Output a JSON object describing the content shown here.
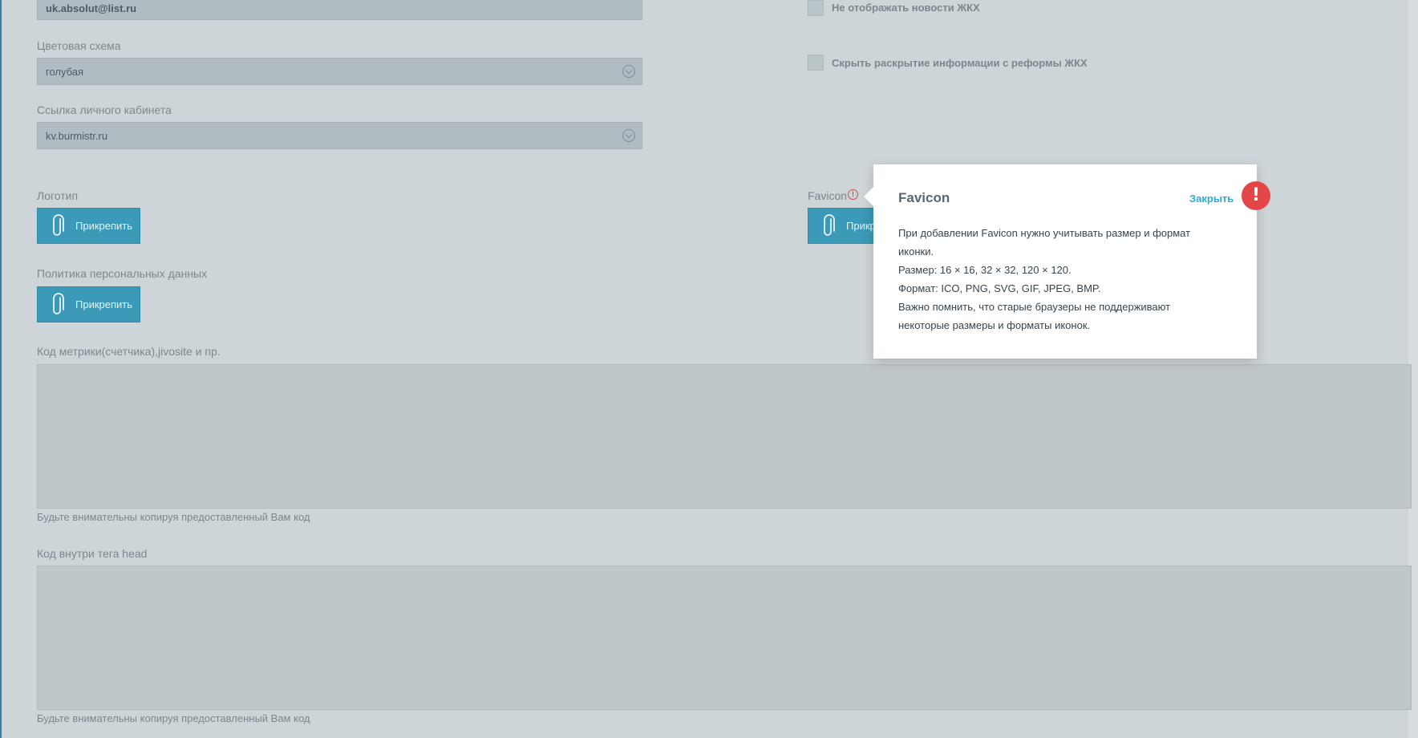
{
  "form": {
    "email_value": "uk.absolut@list.ru",
    "color_scheme": {
      "label": "Цветовая схема",
      "value": "голубая"
    },
    "cabinet_link": {
      "label": "Ссылка личного кабинета",
      "value": "kv.burmistr.ru"
    },
    "logo": {
      "label": "Логотип",
      "button": "Прикрепить"
    },
    "favicon": {
      "label": "Favicon",
      "button": "Прикрепить"
    },
    "privacy": {
      "label": "Политика персональных данных",
      "button": "Прикрепить"
    },
    "metrics_code": {
      "label": "Код метрики(счетчика),jivosite и пр.",
      "hint": "Будьте внимательны копируя предоставленный Вам код"
    },
    "head_code": {
      "label": "Код внутри тега head",
      "hint": "Будьте внимательны копируя предоставленный Вам код"
    }
  },
  "options": {
    "hide_news": "Не отображать новости ЖКХ",
    "hide_disclosure": "Скрыть раскрытие информации с реформы ЖКХ"
  },
  "popup": {
    "title": "Favicon",
    "close": "Закрыть",
    "lines": [
      "При добавлении Favicon нужно учитывать размер и формат иконки.",
      "Размер: 16 × 16, 32 × 32, 120 × 120.",
      "Формат: ICO, PNG, SVG, GIF, JPEG, BMP.",
      "Важно помнить, что старые браузеры не поддерживают некоторые размеры и форматы иконок."
    ],
    "badge": "!"
  },
  "colors": {
    "accent": "#3a9ab8",
    "overlay": "#ced5d8",
    "alert": "#e24646",
    "link": "#2fa9d6"
  },
  "icons": {
    "attach": "paperclip-icon",
    "select": "chevron-down-icon",
    "warning": "warning-icon"
  }
}
